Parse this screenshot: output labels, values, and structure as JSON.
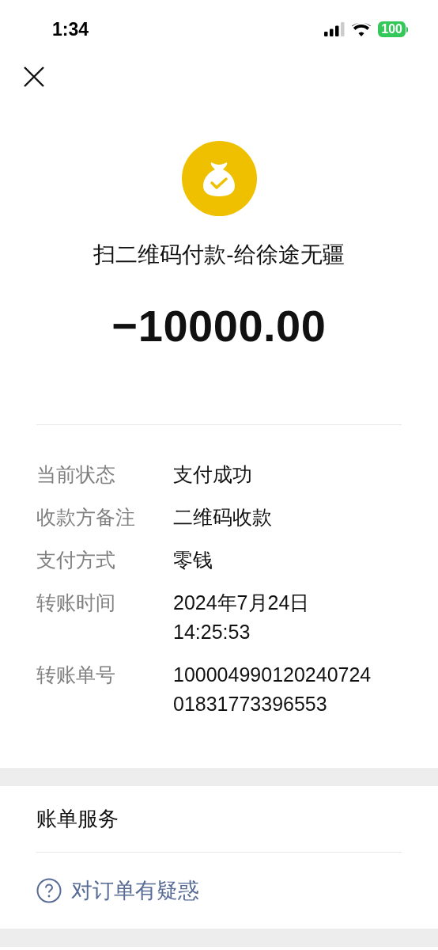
{
  "status_bar": {
    "time": "1:34",
    "battery": "100"
  },
  "payment": {
    "title": "扫二维码付款-给徐途无疆",
    "amount": "−10000.00"
  },
  "details": [
    {
      "label": "当前状态",
      "value": "支付成功"
    },
    {
      "label": "收款方备注",
      "value": "二维码收款"
    },
    {
      "label": "支付方式",
      "value": "零钱"
    },
    {
      "label": "转账时间",
      "value": "2024年7月24日 14:25:53"
    },
    {
      "label": "转账单号",
      "value": "10000499012024072401831773396553"
    }
  ],
  "services": {
    "title": "账单服务",
    "link": "对订单有疑惑"
  }
}
